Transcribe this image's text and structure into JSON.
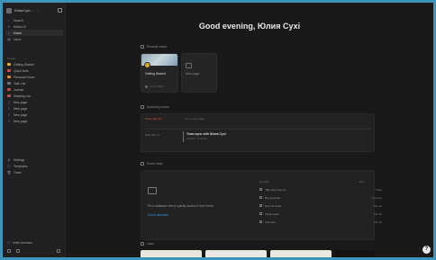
{
  "workspace": {
    "name": "Юлия Сухі ...",
    "chevron": "⌄"
  },
  "sidebar": {
    "top_items": [
      {
        "label": "Search",
        "icon": "search-icon"
      },
      {
        "label": "Notion AI",
        "icon": "ai-icon"
      },
      {
        "label": "Home",
        "icon": "home-icon",
        "active": true
      },
      {
        "label": "Inbox",
        "icon": "inbox-icon"
      }
    ],
    "private_label": "Private",
    "private_items": [
      {
        "label": "Getting Started",
        "color": "#e1a92b"
      },
      {
        "label": "Quick Note",
        "color": "#d04a4a"
      },
      {
        "label": "Personal Home",
        "color": "#e08a2b"
      },
      {
        "label": "Task List",
        "color": "#6f6f6f"
      },
      {
        "label": "Journal",
        "color": "#c04a4a"
      },
      {
        "label": "Reading List",
        "color": "#c04a4a"
      },
      {
        "label": "New page",
        "color": "#6f6f6f"
      },
      {
        "label": "New page",
        "color": "#6f6f6f"
      },
      {
        "label": "New page",
        "color": "#6f6f6f"
      },
      {
        "label": "New page",
        "color": "#6f6f6f"
      }
    ],
    "bottom_items": [
      {
        "label": "Settings",
        "icon": "gear-icon"
      },
      {
        "label": "Templates",
        "icon": "templates-icon"
      },
      {
        "label": "Trash",
        "icon": "trash-icon"
      }
    ],
    "invite_label": "Invite members"
  },
  "main": {
    "greeting": "Good evening, Юлия Сухі",
    "recently_visited": {
      "title": "Recently visited",
      "cards": [
        {
          "title": "Getting Started",
          "meta": "Jul 10, 2024"
        },
        {
          "title": "New page",
          "meta": ""
        }
      ]
    },
    "upcoming_events": {
      "title": "Upcoming events",
      "today_label": "Today Mar 26",
      "today_empty": "No events today",
      "next_date": "Wed Mar 27",
      "event_title": "Team sync with Юлия Сухі",
      "event_sub": "9:00 AM · 10:00 AM"
    },
    "home_views": {
      "title": "Home views",
      "empty_text": "Pin a database view to quickly access it from Home.",
      "link_label": "Select database",
      "table_headers": [
        "My tasks",
        "Due"
      ],
      "tasks": [
        {
          "label": "Take Fig to the vet",
          "due": "Today"
        },
        {
          "label": "Buy groceries",
          "due": "Yesterday"
        },
        {
          "label": "Drop off books",
          "due": "Mar 20"
        },
        {
          "label": "Finish report",
          "due": "Mar 22"
        },
        {
          "label": "Call mom",
          "due": "Mar 25"
        }
      ]
    },
    "learn_title": "Learn"
  },
  "help_label": "?"
}
